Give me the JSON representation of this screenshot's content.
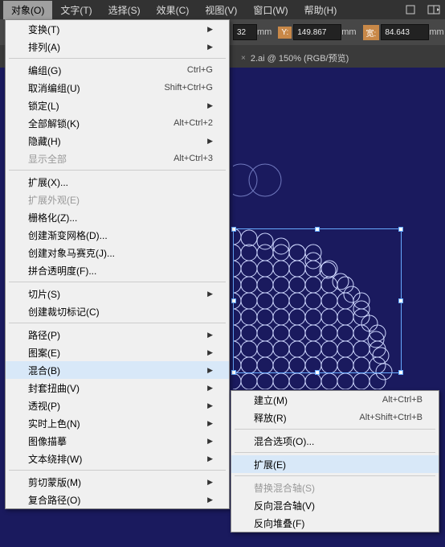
{
  "menubar": {
    "items": [
      "对象(O)",
      "文字(T)",
      "选择(S)",
      "效果(C)",
      "视图(V)",
      "窗口(W)",
      "帮助(H)"
    ]
  },
  "toolbar": {
    "unit_suffix": "mm",
    "x_value": "32",
    "y_label": "Y:",
    "y_value": "149.867",
    "w_label": "宽:",
    "w_value": "84.643"
  },
  "tab": {
    "title": "2.ai @ 150% (RGB/预览)"
  },
  "menu": {
    "items": [
      {
        "label": "变换(T)",
        "arrow": true
      },
      {
        "label": "排列(A)",
        "arrow": true
      },
      {
        "sep": true
      },
      {
        "label": "编组(G)",
        "shortcut": "Ctrl+G"
      },
      {
        "label": "取消编组(U)",
        "shortcut": "Shift+Ctrl+G"
      },
      {
        "label": "锁定(L)",
        "arrow": true
      },
      {
        "label": "全部解锁(K)",
        "shortcut": "Alt+Ctrl+2"
      },
      {
        "label": "隐藏(H)",
        "arrow": true
      },
      {
        "label": "显示全部",
        "shortcut": "Alt+Ctrl+3",
        "disabled": true
      },
      {
        "sep": true
      },
      {
        "label": "扩展(X)..."
      },
      {
        "label": "扩展外观(E)",
        "disabled": true
      },
      {
        "label": "栅格化(Z)..."
      },
      {
        "label": "创建渐变网格(D)..."
      },
      {
        "label": "创建对象马赛克(J)..."
      },
      {
        "label": "拼合透明度(F)..."
      },
      {
        "sep": true
      },
      {
        "label": "切片(S)",
        "arrow": true
      },
      {
        "label": "创建裁切标记(C)"
      },
      {
        "sep": true
      },
      {
        "label": "路径(P)",
        "arrow": true
      },
      {
        "label": "图案(E)",
        "arrow": true
      },
      {
        "label": "混合(B)",
        "arrow": true,
        "highlighted": true
      },
      {
        "label": "封套扭曲(V)",
        "arrow": true
      },
      {
        "label": "透视(P)",
        "arrow": true
      },
      {
        "label": "实时上色(N)",
        "arrow": true
      },
      {
        "label": "图像描摹",
        "arrow": true
      },
      {
        "label": "文本绕排(W)",
        "arrow": true
      },
      {
        "sep": true
      },
      {
        "label": "剪切蒙版(M)",
        "arrow": true
      },
      {
        "label": "复合路径(O)",
        "arrow": true
      }
    ]
  },
  "submenu": {
    "items": [
      {
        "label": "建立(M)",
        "shortcut": "Alt+Ctrl+B"
      },
      {
        "label": "释放(R)",
        "shortcut": "Alt+Shift+Ctrl+B"
      },
      {
        "sep": true
      },
      {
        "label": "混合选项(O)..."
      },
      {
        "sep": true
      },
      {
        "label": "扩展(E)",
        "highlighted": true
      },
      {
        "sep": true
      },
      {
        "label": "替换混合轴(S)",
        "disabled": true
      },
      {
        "label": "反向混合轴(V)"
      },
      {
        "label": "反向堆叠(F)"
      }
    ]
  }
}
